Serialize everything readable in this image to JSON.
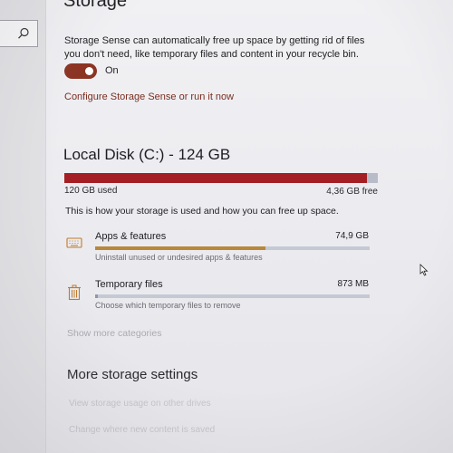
{
  "page": {
    "title": "Storage"
  },
  "storage_sense": {
    "description": "Storage Sense can automatically free up space by getting rid of files you don't need, like temporary files and content in your recycle bin.",
    "toggle_state": "On",
    "toggle_on": true,
    "configure_link": "Configure Storage Sense or run it now"
  },
  "disk": {
    "title": "Local Disk (C:) - 124 GB",
    "used_label": "120 GB used",
    "free_label": "4,36 GB free",
    "used_fraction": 0.965,
    "info_text": "This is how your storage is used and how you can free up space."
  },
  "categories": [
    {
      "icon": "keyboard-icon",
      "name": "Apps & features",
      "size": "74,9 GB",
      "subtext": "Uninstall unused or undesired apps & features",
      "fill_fraction": 0.62,
      "bar_color": "#b8883a"
    },
    {
      "icon": "trash-icon",
      "name": "Temporary files",
      "size": "873 MB",
      "subtext": "Choose which temporary files to remove",
      "fill_fraction": 0.01,
      "bar_color": "#8d97ae"
    }
  ],
  "show_more": "Show more categories",
  "more_settings": {
    "title": "More storage settings",
    "links": [
      "View storage usage on other drives",
      "Change where new content is saved"
    ]
  },
  "colors": {
    "accent": "#8c3423",
    "link": "#7a2d1f",
    "disk_used": "#a31f24",
    "disk_free": "#b7bcc8"
  }
}
